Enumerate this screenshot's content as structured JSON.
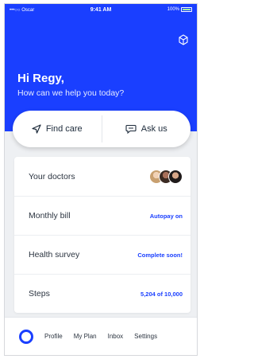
{
  "status_bar": {
    "carrier": "•••○○ Oscar",
    "time": "9:41 AM",
    "battery": "100%"
  },
  "header": {
    "greeting": "Hi Regy,",
    "subtitle": "How can we help you today?"
  },
  "actions": {
    "find_care": "Find care",
    "ask_us": "Ask us"
  },
  "summary": {
    "doctors_label": "Your doctors",
    "bill_label": "Monthly bill",
    "bill_value": "Autopay on",
    "survey_label": "Health survey",
    "survey_value": "Complete soon!",
    "steps_label": "Steps",
    "steps_value": "5,204 of 10,000"
  },
  "tabs": [
    "Profile",
    "My Plan",
    "Inbox",
    "Settings"
  ],
  "colors": {
    "brand": "#1a3fff",
    "background": "#eef0f3"
  },
  "icons": {
    "account": "account-icon",
    "find_care": "navigation-arrow-icon",
    "ask_us": "chat-bubble-icon",
    "home": "home-ring-icon"
  }
}
